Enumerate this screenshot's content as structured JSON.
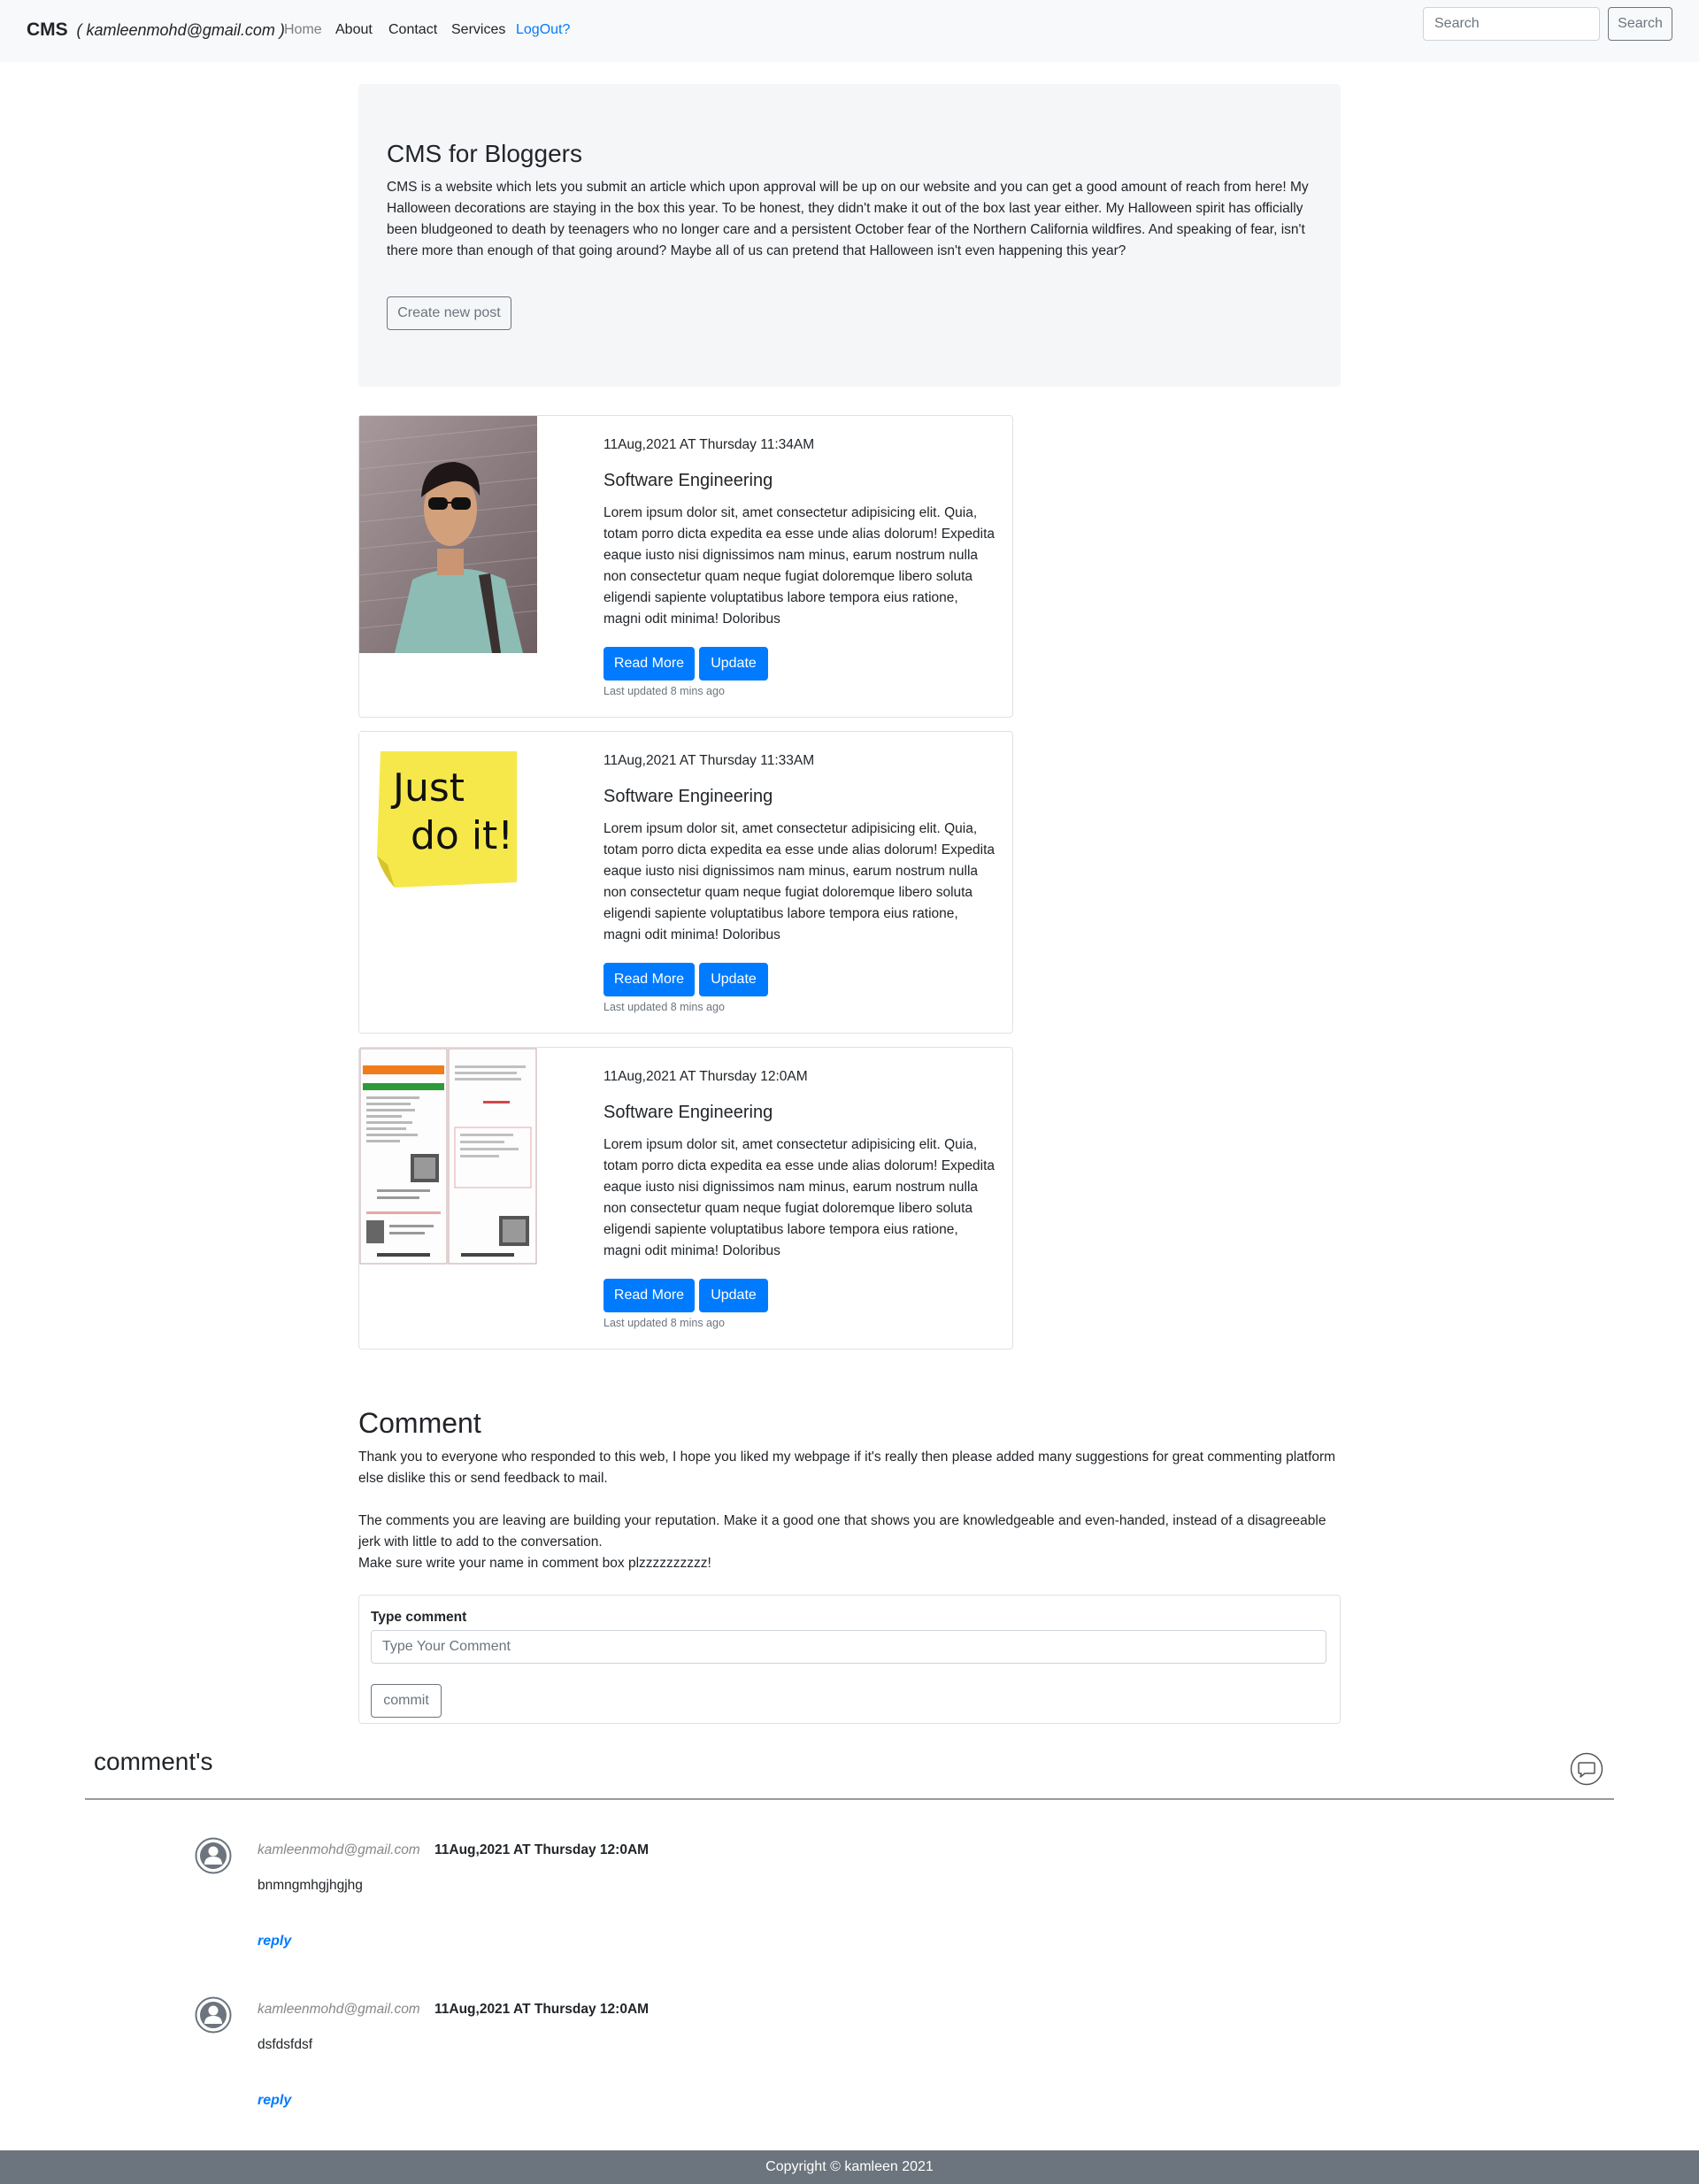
{
  "navbar": {
    "brand": "CMS",
    "user_email": "( kamleenmohd@gmail.com )",
    "links": [
      "Home",
      "About",
      "Contact",
      "Services",
      "LogOut?"
    ],
    "search_placeholder": "Search",
    "search_button": "Search"
  },
  "jumbotron": {
    "title": "CMS for Bloggers",
    "text": "CMS is a website which lets you submit an article which upon approval will be up on our website and you can get a good amount of reach from here! My Halloween decorations are staying in the box this year. To be honest, they didn't make it out of the box last year either. My Halloween spirit has officially been bludgeoned to death by teenagers who no longer care and a persistent October fear of the Northern California wildfires. And speaking of fear, isn't there more than enough of that going around? Maybe all of us can pretend that Halloween isn't even happening this year?",
    "create_button": "Create new post"
  },
  "posts": [
    {
      "date": "11Aug,2021 AT Thursday 11:34AM",
      "title": "Software Engineering",
      "text": "Lorem ipsum dolor sit, amet consectetur adipisicing elit. Quia, totam porro dicta expedita ea esse unde alias dolorum! Expedita eaque iusto nisi dignissimos nam minus, earum nostrum nulla non consectetur quam neque fugiat doloremque libero soluta eligendi sapiente voluptatibus labore tempora eius ratione, magni odit minima! Doloribus",
      "read_more": "Read More",
      "update": "Update",
      "updated": "Last updated 8 mins ago"
    },
    {
      "date": "11Aug,2021 AT Thursday 11:33AM",
      "title": "Software Engineering",
      "text": "Lorem ipsum dolor sit, amet consectetur adipisicing elit. Quia, totam porro dicta expedita ea esse unde alias dolorum! Expedita eaque iusto nisi dignissimos nam minus, earum nostrum nulla non consectetur quam neque fugiat doloremque libero soluta eligendi sapiente voluptatibus labore tempora eius ratione, magni odit minima! Doloribus",
      "read_more": "Read More",
      "update": "Update",
      "updated": "Last updated 8 mins ago",
      "image_text_line1": "Just",
      "image_text_line2": "do it!"
    },
    {
      "date": "11Aug,2021 AT Thursday 12:0AM",
      "title": "Software Engineering",
      "text": "Lorem ipsum dolor sit, amet consectetur adipisicing elit. Quia, totam porro dicta expedita ea esse unde alias dolorum! Expedita eaque iusto nisi dignissimos nam minus, earum nostrum nulla non consectetur quam neque fugiat doloremque libero soluta eligendi sapiente voluptatibus labore tempora eius ratione, magni odit minima! Doloribus",
      "read_more": "Read More",
      "update": "Update",
      "updated": "Last updated 8 mins ago"
    }
  ],
  "comment_section": {
    "heading": "Comment",
    "para1": "Thank you to everyone who responded to this web, I hope you liked my webpage if it's really then please added many suggestions for great commenting platform else dislike this or send feedback to mail.",
    "para2": "The comments you are leaving are building your reputation. Make it a good one that shows you are knowledgeable and even-handed, instead of a disagreeable jerk with little to add to the conversation.",
    "para3": "Make sure write your name in comment box plzzzzzzzzzz!",
    "form_label": "Type comment",
    "input_placeholder": "Type Your Comment",
    "commit_button": "commit"
  },
  "comments_list": {
    "title": "comment's",
    "items": [
      {
        "user": "kamleenmohd@gmail.com",
        "date": "11Aug,2021 AT Thursday 12:0AM",
        "text": "bnmngmhgjhgjhg",
        "reply": "reply"
      },
      {
        "user": "kamleenmohd@gmail.com",
        "date": "11Aug,2021 AT Thursday 12:0AM",
        "text": "dsfdsfdsf",
        "reply": "reply"
      }
    ]
  },
  "footer": "Copyright © kamleen 2021",
  "colors": {
    "primary": "#007bff",
    "navbar_bg": "#f8f9fa",
    "jumbotron_bg": "#f5f6f8",
    "footer_bg": "#6c757d"
  }
}
